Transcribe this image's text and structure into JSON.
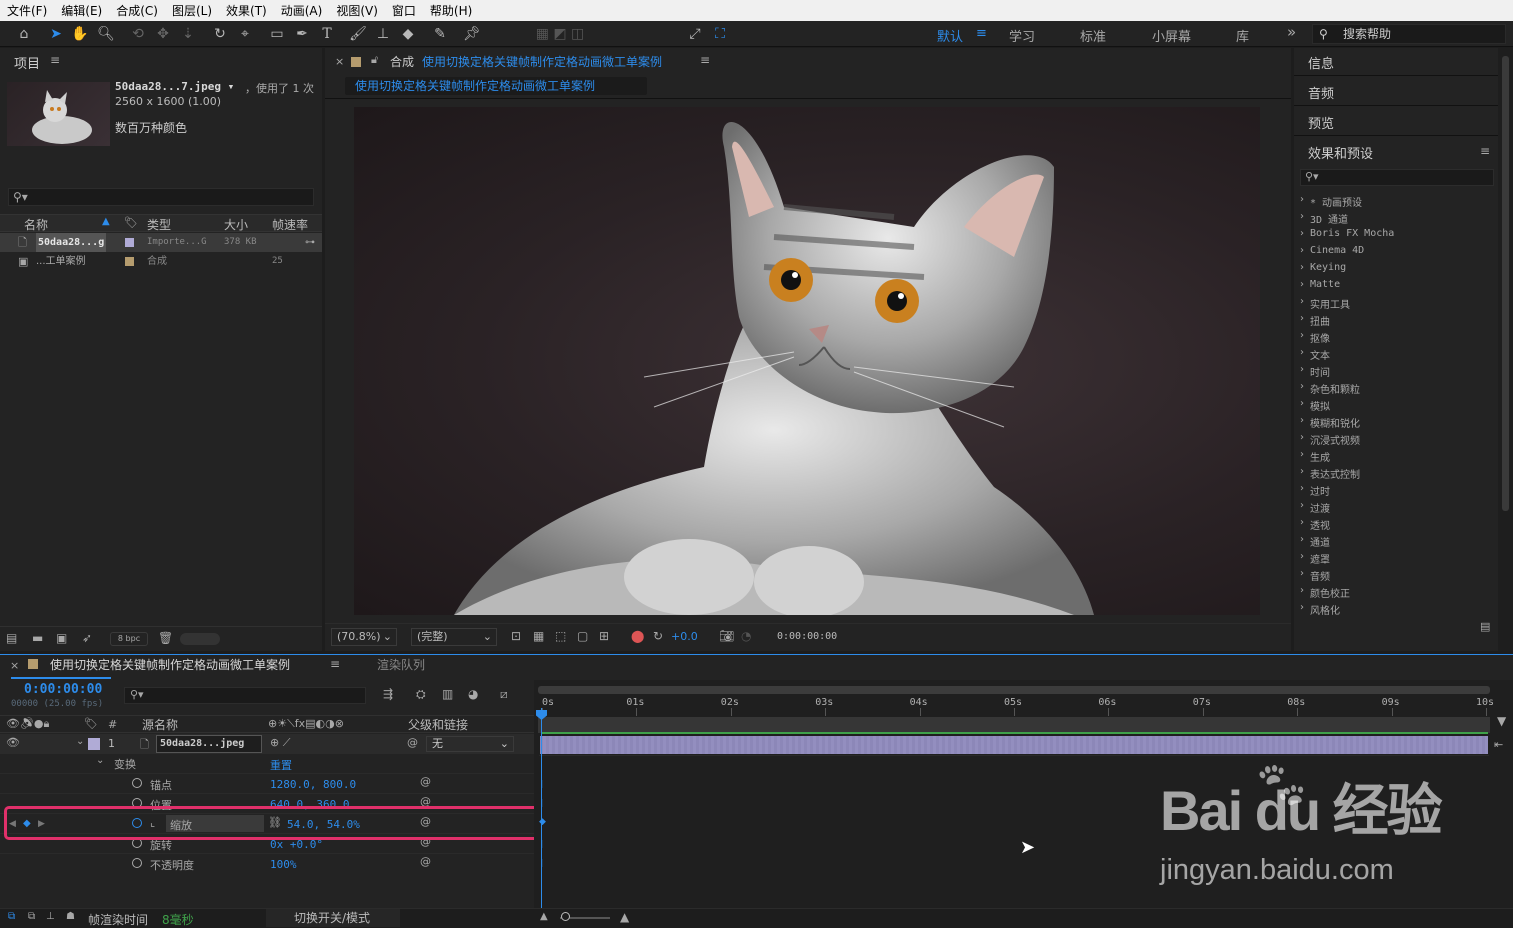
{
  "menu": [
    "文件(F)",
    "编辑(E)",
    "合成(C)",
    "图层(L)",
    "效果(T)",
    "动画(A)",
    "视图(V)",
    "窗口",
    "帮助(H)"
  ],
  "toolbar": {
    "align_label": "对齐",
    "workspaces": [
      "默认",
      "学习",
      "标准",
      "小屏幕",
      "库"
    ],
    "more": "»",
    "search_help": "搜索帮助"
  },
  "project": {
    "title": "项目",
    "file_name": "50daa28...7.jpeg ▾",
    "used": "，使用了 1 次",
    "dims": "2560 x 1600 (1.00)",
    "colors": "数百万种颜色",
    "columns": [
      "名称",
      "类型",
      "大小",
      "帧速率"
    ],
    "items": [
      {
        "name": "50daa28...g",
        "type": "Importe...G",
        "size": "378 KB",
        "fps": ""
      },
      {
        "name": "...工单案例",
        "type": "合成",
        "size": "",
        "fps": "25"
      }
    ],
    "bpc": "8 bpc"
  },
  "viewer": {
    "comp_prefix": "合成",
    "comp_name": "使用切换定格关键帧制作定格动画微工单案例",
    "tab_label": "使用切换定格关键帧制作定格动画微工单案例",
    "zoom": "(70.8%)",
    "quality": "(完整)",
    "exposure": "+0.0",
    "timecode": "0:00:00:00"
  },
  "right_panel": {
    "tabs": [
      "信息",
      "音频",
      "预览"
    ],
    "effects_title": "效果和预设",
    "effects": [
      "* 动画预设",
      "3D 通道",
      "Boris FX Mocha",
      "Cinema 4D",
      "Keying",
      "Matte",
      "实用工具",
      "扭曲",
      "抠像",
      "文本",
      "时间",
      "杂色和颗粒",
      "模拟",
      "模糊和锐化",
      "沉浸式视频",
      "生成",
      "表达式控制",
      "过时",
      "过渡",
      "透视",
      "通道",
      "遮罩",
      "音频",
      "颜色校正",
      "风格化"
    ]
  },
  "timeline": {
    "comp_tab": "使用切换定格关键帧制作定格动画微工单案例",
    "render_queue": "渲染队列",
    "timecode": "0:00:00:00",
    "frames": "00000 (25.00 fps)",
    "col_source": "源名称",
    "col_parent": "父级和链接",
    "layer_num": "1",
    "layer_name": "50daa28...jpeg",
    "parent": "无",
    "transform": "变换",
    "reset": "重置",
    "props": [
      {
        "name": "锚点",
        "value": "1280.0, 800.0"
      },
      {
        "name": "位置",
        "value": "640.0, 360.0"
      },
      {
        "name": "缩放",
        "value": "54.0, 54.0%"
      },
      {
        "name": "旋转",
        "value": "0x +0.0°"
      },
      {
        "name": "不透明度",
        "value": "100%"
      }
    ],
    "ticks": [
      "0s",
      "01s",
      "02s",
      "03s",
      "04s",
      "05s",
      "06s",
      "07s",
      "08s",
      "09s",
      "10s"
    ],
    "render_time_label": "帧渲染时间",
    "render_time": "8毫秒",
    "toggle_modes": "切换开关/模式"
  },
  "watermark": {
    "brand": "Bai du 经验",
    "url": "jingyan.baidu.com"
  },
  "colors": {
    "accent": "#2d8ceb",
    "highlight": "#e0306a",
    "layer_bar": "#8c87b8"
  }
}
